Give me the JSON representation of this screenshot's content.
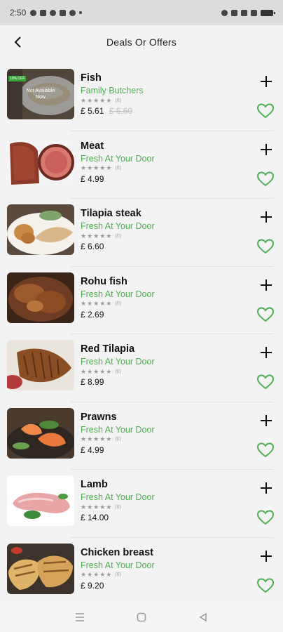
{
  "status": {
    "time": "2:50"
  },
  "header": {
    "title": "Deals Or Offers"
  },
  "badge": {
    "off_text": "10% OFF",
    "not_available": "Not Available Now"
  },
  "colors": {
    "accent": "#4caf50",
    "price": "#111111",
    "muted": "#9a9a9a"
  },
  "items": [
    {
      "name": "Fish",
      "seller": "Family Butchers",
      "stars": "★★★★★",
      "reviews": "(0)",
      "price": "£ 5.61",
      "old_price": "£ 6.60",
      "image": "fish-plate",
      "available": false
    },
    {
      "name": "Meat",
      "seller": "Fresh At Your Door",
      "stars": "★★★★★",
      "reviews": "(0)",
      "price": "£ 4.99",
      "image": "steak"
    },
    {
      "name": "Tilapia steak",
      "seller": "Fresh At Your Door",
      "stars": "★★★★★",
      "reviews": "(0)",
      "price": "£ 6.60",
      "image": "tilapia-plate"
    },
    {
      "name": "Rohu fish",
      "seller": "Fresh At Your Door",
      "stars": "★★★★★",
      "reviews": "(0)",
      "price": "£ 2.69",
      "image": "rohu-curry"
    },
    {
      "name": "Red Tilapia",
      "seller": "Fresh At Your Door",
      "stars": "★★★★★",
      "reviews": "(0)",
      "price": "£ 8.99",
      "image": "grilled-fish"
    },
    {
      "name": "Prawns",
      "seller": "Fresh At Your Door",
      "stars": "★★★★★",
      "reviews": "(0)",
      "price": "£ 4.99",
      "image": "prawns"
    },
    {
      "name": "Lamb",
      "seller": "Fresh At Your Door",
      "stars": "★★★★★",
      "reviews": "(0)",
      "price": "£ 14.00",
      "image": "lamb-leg"
    },
    {
      "name": "Chicken breast",
      "seller": "Fresh At Your Door",
      "stars": "★★★★★",
      "reviews": "(0)",
      "price": "£ 9.20",
      "image": "chicken-breast"
    }
  ],
  "icons": {
    "back": "arrow-left-icon",
    "add": "plus-icon",
    "favorite": "heart-outline-icon",
    "nav": [
      "menu-icon",
      "home-square-icon",
      "back-triangle-icon"
    ]
  }
}
